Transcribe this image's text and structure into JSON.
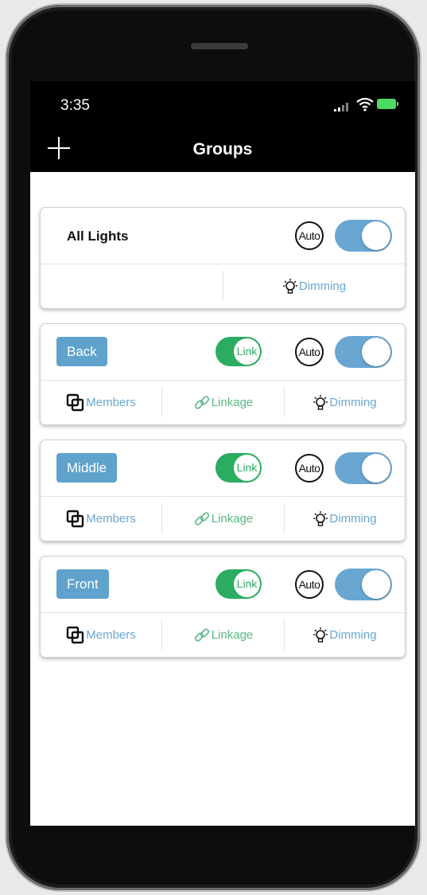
{
  "status": {
    "time": "3:35"
  },
  "nav": {
    "title": "Groups"
  },
  "all_lights": {
    "title": "All Lights",
    "auto_label": "Auto",
    "power_on": true,
    "dimming_label": "Dimming"
  },
  "groups": [
    {
      "name": "Back",
      "link_label": "Link",
      "link_on": true,
      "auto_label": "Auto",
      "power_on": true,
      "members_label": "Members",
      "linkage_label": "Linkage",
      "dimming_label": "Dimming"
    },
    {
      "name": "Middle",
      "link_label": "Link",
      "link_on": true,
      "auto_label": "Auto",
      "power_on": true,
      "members_label": "Members",
      "linkage_label": "Linkage",
      "dimming_label": "Dimming"
    },
    {
      "name": "Front",
      "link_label": "Link",
      "link_on": true,
      "auto_label": "Auto",
      "power_on": true,
      "members_label": "Members",
      "linkage_label": "Linkage",
      "dimming_label": "Dimming"
    }
  ],
  "icons": {
    "add": "plus-icon",
    "members": "members-icon",
    "linkage": "chain-link-icon",
    "dimming": "lightbulb-icon",
    "signal": "signal-icon",
    "wifi": "wifi-icon",
    "battery": "battery-charging-icon"
  },
  "colors": {
    "group_button": "#5fa3cd",
    "power_toggle": "#69a7d2",
    "link_toggle": "#2aac61",
    "action_blue": "#6aa6d0",
    "action_green": "#58b883"
  }
}
